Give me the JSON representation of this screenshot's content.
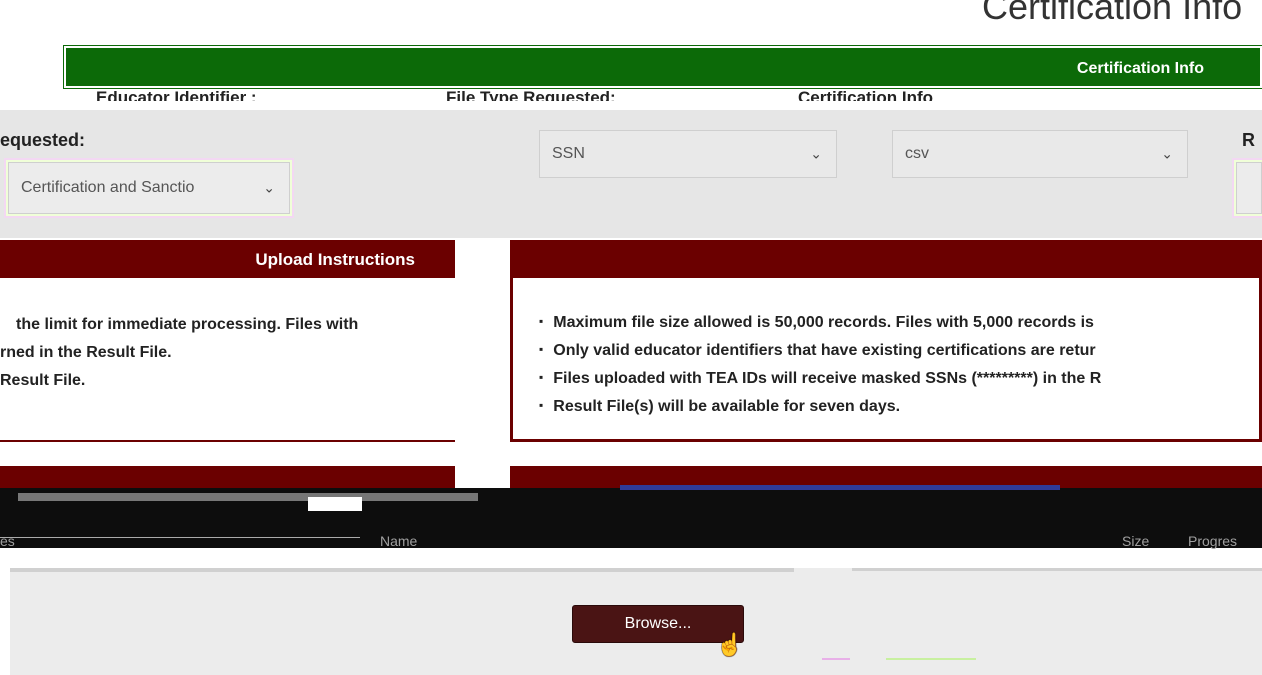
{
  "page": {
    "title": "Certification Info"
  },
  "banner": {
    "label": "Certification Info"
  },
  "columns": {
    "educator_identifier": "Educator Identifier :",
    "file_type_requested": "File Type Requested:",
    "certification_info": "Certification Info"
  },
  "form": {
    "requested_label": "equested:",
    "right_label": "R",
    "info_select_value": "Certification and Sanctio",
    "identifier_select_value": "SSN",
    "file_type_select_value": "csv"
  },
  "upload_instructions": {
    "title": "Upload Instructions",
    "left_lines": [
      "the limit for immediate processing. Files with",
      "rned in the Result File.",
      "Result File."
    ],
    "right_lines": [
      "Maximum file size allowed is 50,000 records. Files with 5,000 records is",
      "Only valid educator identifiers that have existing certifications are retur",
      "Files uploaded with TEA IDs will receive masked SSNs (*********) in the R",
      "Result File(s) will be available for seven days."
    ]
  },
  "file_grid": {
    "col_left": "es",
    "col_name": "Name",
    "col_size": "Size",
    "col_progress": "Progres"
  },
  "actions": {
    "browse_label": "Browse..."
  },
  "colors": {
    "green": "#0c6a08",
    "maroon": "#6b0000",
    "button": "#4a1414"
  }
}
